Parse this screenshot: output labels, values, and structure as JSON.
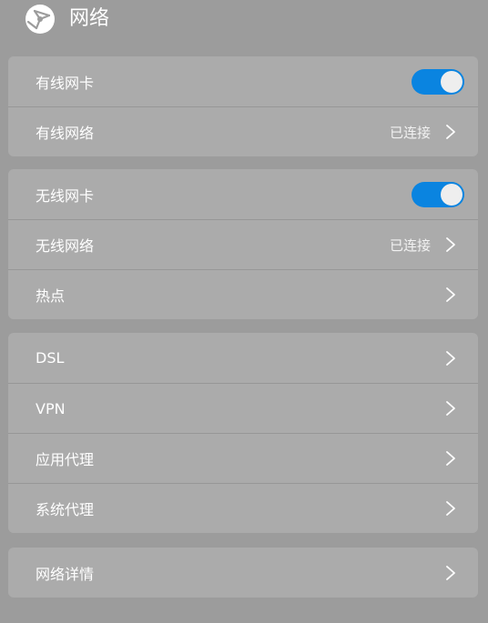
{
  "header": {
    "title": "网络",
    "icon": "globe-network-icon"
  },
  "colors": {
    "background": "#9c9c9c",
    "card": "#ababab",
    "toggle_on": "#0a84e0"
  },
  "wired": {
    "card_label": "有线网卡",
    "card_enabled": true,
    "network_label": "有线网络",
    "network_status": "已连接"
  },
  "wireless": {
    "card_label": "无线网卡",
    "card_enabled": true,
    "network_label": "无线网络",
    "network_status": "已连接",
    "hotspot_label": "热点"
  },
  "advanced": {
    "dsl_label": "DSL",
    "vpn_label": "VPN",
    "app_proxy_label": "应用代理",
    "system_proxy_label": "系统代理"
  },
  "details": {
    "label": "网络详情"
  }
}
